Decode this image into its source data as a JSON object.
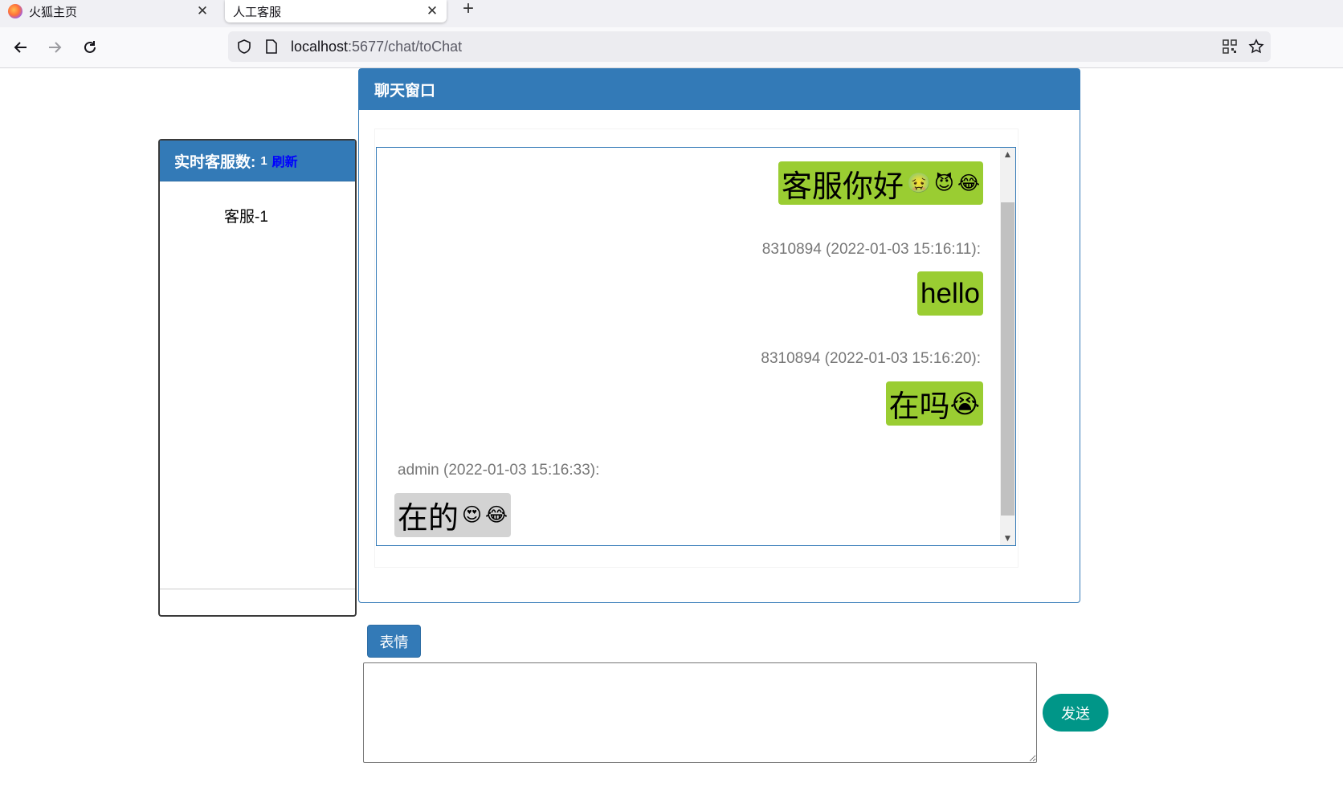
{
  "browser": {
    "tabs": [
      {
        "label": "火狐主页",
        "icon": "firefox-icon",
        "active": false
      },
      {
        "label": "人工客服",
        "icon": "",
        "active": true
      }
    ],
    "url_host": "localhost",
    "url_path": ":5677/chat/toChat"
  },
  "left_panel": {
    "title": "实时客服数:",
    "count": "1",
    "refresh_label": "刷新",
    "agents": [
      "客服-1"
    ]
  },
  "chat": {
    "title": "聊天窗口",
    "messages": [
      {
        "side": "right",
        "meta": "",
        "text": "客服你好",
        "emojis": [
          "🤢",
          "😈",
          "😂"
        ]
      },
      {
        "side": "right",
        "meta": "8310894 (2022-01-03 15:16:11):",
        "text": "hello",
        "emojis": []
      },
      {
        "side": "right",
        "meta": "8310894 (2022-01-03 15:16:20):",
        "text": "在吗",
        "emojis": [
          "😭"
        ]
      },
      {
        "side": "left",
        "meta": "admin (2022-01-03 15:16:33):",
        "text": "在的",
        "emojis": [
          "😍",
          "😂"
        ]
      }
    ]
  },
  "composer": {
    "emoji_label": "表情",
    "send_label": "发送",
    "input_value": ""
  },
  "colors": {
    "primary": "#337ab7",
    "own_bubble": "#9acd32",
    "other_bubble": "#d3d3d3",
    "send": "#009688",
    "refresh_link": "#0000ff"
  }
}
